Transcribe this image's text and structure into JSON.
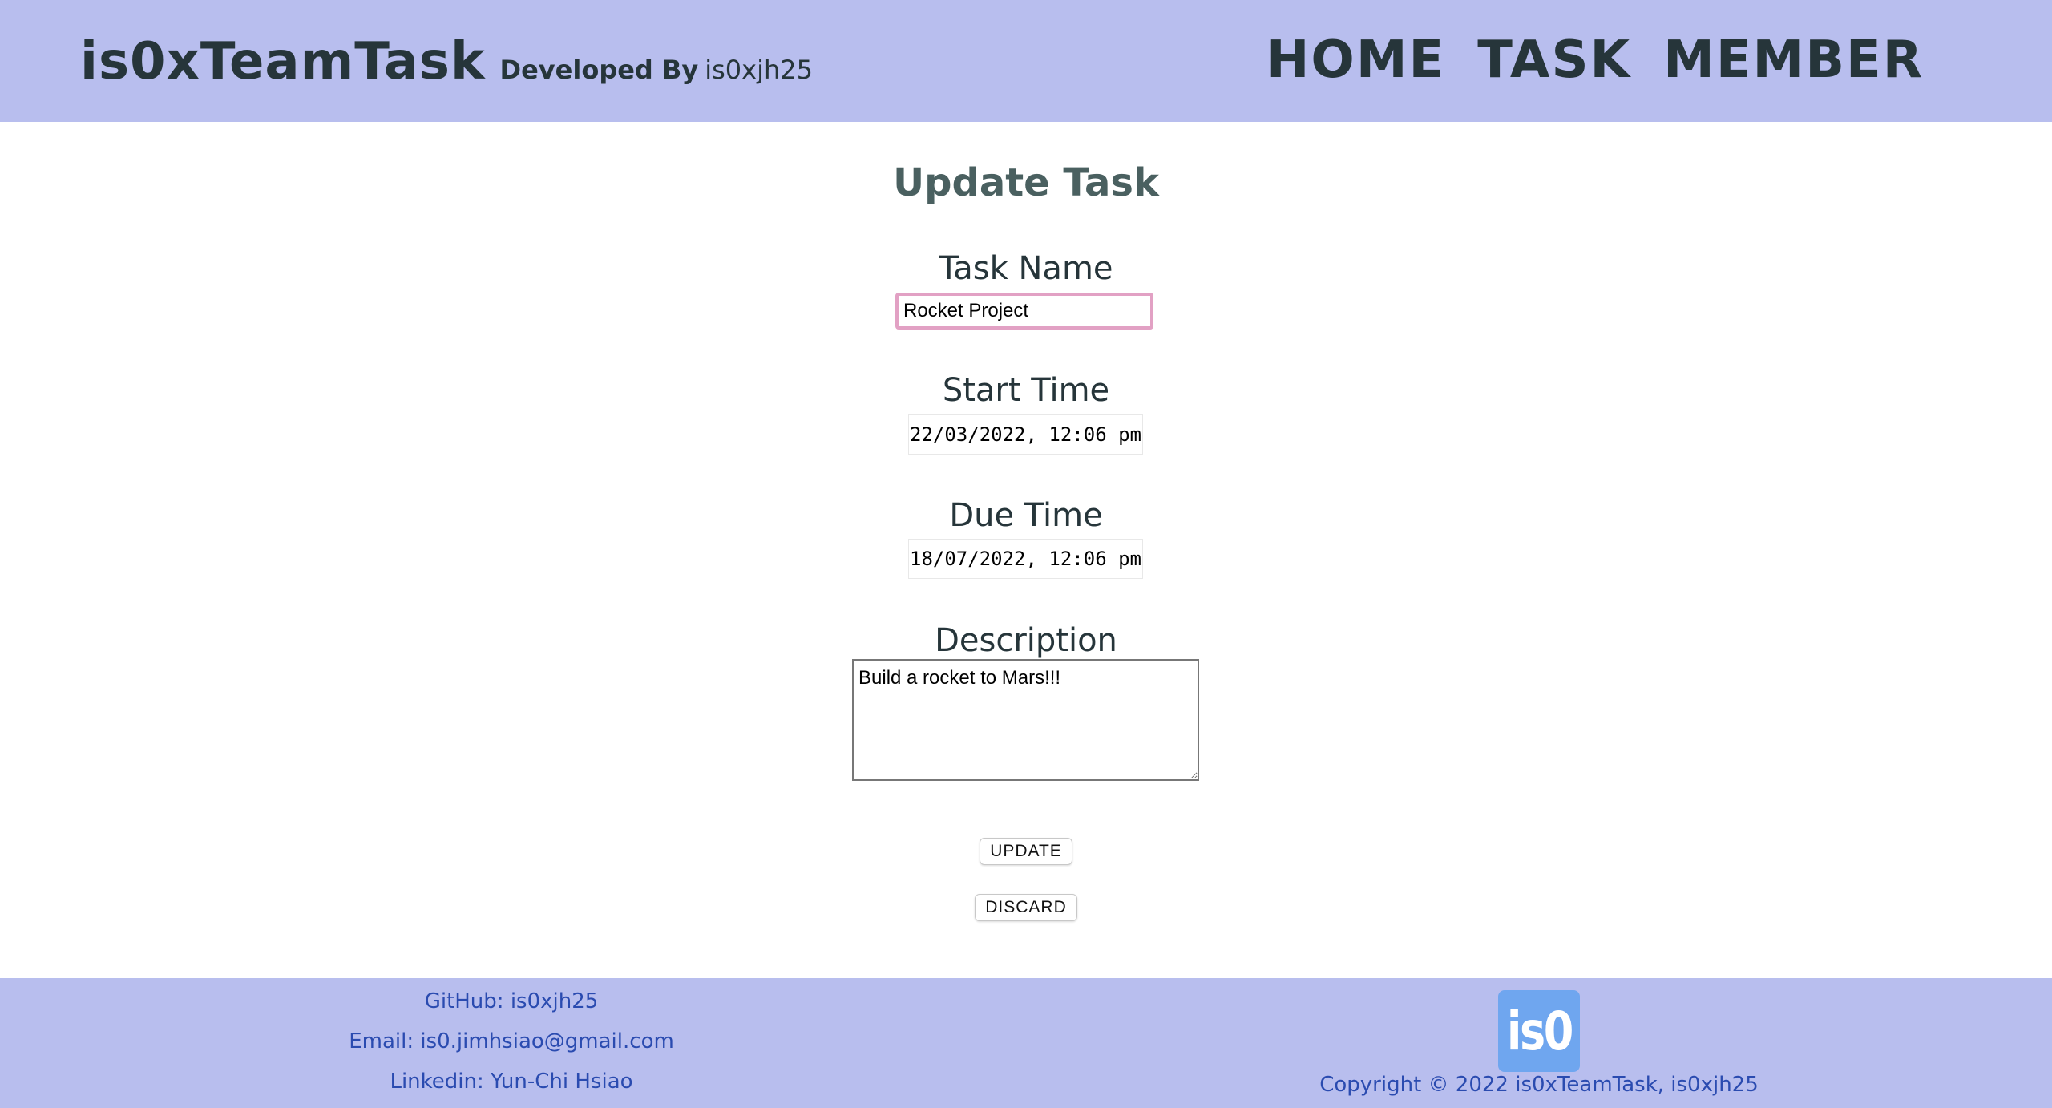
{
  "header": {
    "brand": "is0xTeamTask",
    "developed_by_label": "Developed By",
    "developer": "is0xjh25",
    "nav": [
      "HOME",
      "TASK",
      "MEMBER"
    ]
  },
  "form": {
    "title": "Update Task",
    "task_name_label": "Task Name",
    "task_name_value": "Rocket Project",
    "start_time_label": "Start Time",
    "start_time_value": "22/03/2022, 12:06 pm",
    "due_time_label": "Due Time",
    "due_time_value": "18/07/2022, 12:06 pm",
    "description_label": "Description",
    "description_value": "Build a rocket to Mars!!!",
    "update_label": "UPDATE",
    "discard_label": "DISCARD"
  },
  "footer": {
    "github": "GitHub: is0xjh25",
    "email": "Email: is0.jimhsiao@gmail.com",
    "linkedin": "Linkedin: Yun-Chi Hsiao",
    "logo_text": "is0",
    "copyright": "Copyright © 2022 is0xTeamTask, is0xjh25"
  },
  "colors": {
    "header_bg": "#b8beee",
    "footer_bg": "#b8beee",
    "title_color": "#4a6060",
    "focus_border": "#e2a1c4",
    "link_color": "#2a4bb0",
    "logo_bg": "#6fa6ef"
  }
}
